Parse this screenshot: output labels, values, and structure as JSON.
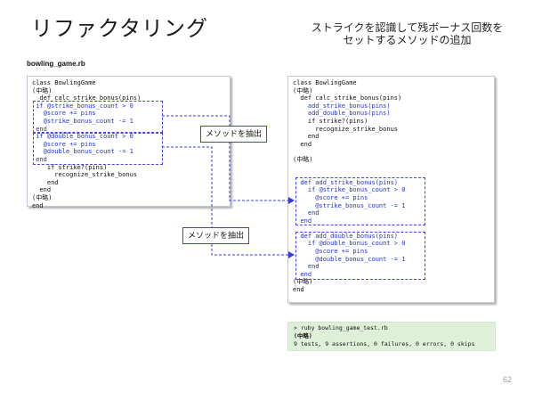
{
  "slide": {
    "title": "リファクタリング",
    "subtitle_line1": "ストライクを認識して残ボーナス回数を",
    "subtitle_line2": "セットするメソッドの追加",
    "page_number": "62"
  },
  "file_label": "bowling_game.rb",
  "colors": {
    "code_highlight_blue": "#2233bb",
    "annotation_blue": "#4444dd",
    "terminal_background_green": "#dff0d8"
  },
  "left_panel": {
    "lines": [
      {
        "t": "class BowlingGame",
        "c": "k"
      },
      {
        "t": "(中略)",
        "c": "k"
      },
      {
        "t": "  def calc_strike_bonus(pins)",
        "c": "k"
      },
      {
        "t": " if @strike_bonus_count > 0",
        "c": "b"
      },
      {
        "t": "   @score += pins",
        "c": "b"
      },
      {
        "t": "   @strike_bonus_count -= 1",
        "c": "b"
      },
      {
        "t": " end",
        "c": "b"
      },
      {
        "t": " if @double_bonus_count > 0",
        "c": "b"
      },
      {
        "t": "   @score += pins",
        "c": "b"
      },
      {
        "t": "   @double_bonus_count -= 1",
        "c": "b"
      },
      {
        "t": " end",
        "c": "b"
      },
      {
        "t": "    if strike?(pins)",
        "c": "k"
      },
      {
        "t": "      recognize_strike_bonus",
        "c": "k"
      },
      {
        "t": "    end",
        "c": "k"
      },
      {
        "t": "  end",
        "c": "k"
      },
      {
        "t": "(中略)",
        "c": "k"
      },
      {
        "t": "end",
        "c": "k"
      }
    ]
  },
  "right_panel": {
    "lines": [
      {
        "t": "class BowlingGame",
        "c": "k"
      },
      {
        "t": "(中略)",
        "c": "k"
      },
      {
        "t": "  def calc_strike_bonus(pins)",
        "c": "k"
      },
      {
        "t": "    add_strike_bonus(pins)",
        "c": "b"
      },
      {
        "t": "    add_double_bonus(pins)",
        "c": "b"
      },
      {
        "t": "    if strike?(pins)",
        "c": "k"
      },
      {
        "t": "      recognize_strike_bonus",
        "c": "k"
      },
      {
        "t": "    end",
        "c": "k"
      },
      {
        "t": "  end",
        "c": "k"
      },
      {
        "t": "",
        "c": "k"
      },
      {
        "t": "(中略)",
        "c": "k"
      },
      {
        "t": "",
        "c": "k"
      },
      {
        "t": "",
        "c": "k"
      },
      {
        "t": "  def add_strike_bonus(pins)",
        "c": "b"
      },
      {
        "t": "    if @strike_bonus_count > 0",
        "c": "b"
      },
      {
        "t": "      @score += pins",
        "c": "b"
      },
      {
        "t": "      @strike_bonus_count -= 1",
        "c": "b"
      },
      {
        "t": "    end",
        "c": "b"
      },
      {
        "t": "  end",
        "c": "b"
      },
      {
        "t": "",
        "c": "k"
      },
      {
        "t": "  def add_double_bonus(pins)",
        "c": "b"
      },
      {
        "t": "    if @double_bonus_count > 0",
        "c": "b"
      },
      {
        "t": "      @score += pins",
        "c": "b"
      },
      {
        "t": "      @double_bonus_count -= 1",
        "c": "b"
      },
      {
        "t": "    end",
        "c": "b"
      },
      {
        "t": "  end",
        "c": "b"
      },
      {
        "t": "(中略)",
        "c": "k"
      },
      {
        "t": "end",
        "c": "k"
      }
    ]
  },
  "annotations": {
    "extract_label_1": "メソッドを抽出",
    "extract_label_2": "メソッドを抽出"
  },
  "terminal": {
    "lines": [
      {
        "t": "> ruby bowling_game_test.rb",
        "c": "k"
      },
      {
        "t": "(中略)",
        "c": "bold"
      },
      {
        "t": "9 tests, 9 assertions, 0 failures, 0 errors, 0 skips",
        "c": "k"
      }
    ]
  }
}
